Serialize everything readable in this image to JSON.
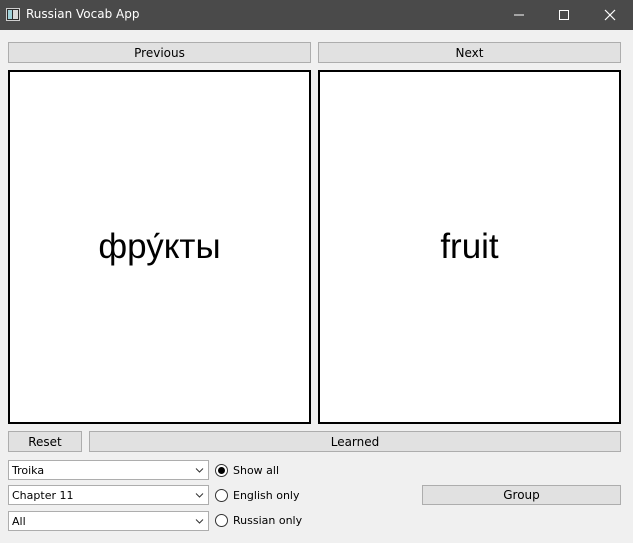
{
  "window": {
    "title": "Russian Vocab App",
    "icons": [
      "app-icon",
      "minimize-icon",
      "maximize-icon",
      "close-icon"
    ]
  },
  "nav": {
    "previous_label": "Previous",
    "next_label": "Next"
  },
  "cards": {
    "russian_word": "фру́кты",
    "english_word": "fruit"
  },
  "actions": {
    "reset_label": "Reset",
    "learned_label": "Learned",
    "group_label": "Group"
  },
  "selectors": {
    "book": "Troika",
    "chapter": "Chapter 11",
    "filter": "All"
  },
  "display_mode": {
    "options": [
      "Show all",
      "English only",
      "Russian only"
    ],
    "selected": "Show all"
  }
}
